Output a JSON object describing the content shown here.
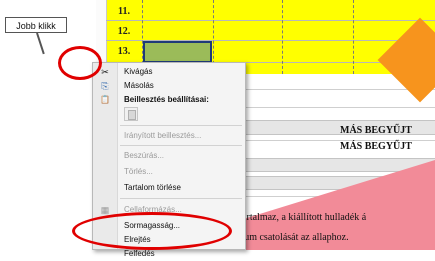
{
  "sheet": {
    "row_numbers": [
      "11.",
      "12.",
      "13."
    ],
    "mas_texts": [
      "MÁS BEGYŰJT",
      "MÁS BEGYŰJT"
    ],
    "bottom_texts": [
      "t tartalmaz, a kiállított hulladék á",
      "entum csatolását az allaphoz."
    ]
  },
  "callout": {
    "label": "Jobb klikk"
  },
  "context_menu": {
    "items": [
      {
        "label": "Kivágás",
        "icon": "scissors-icon",
        "glyph": "✂",
        "state": "enabled"
      },
      {
        "label": "Másolás",
        "icon": "copy-icon",
        "glyph": "⎘",
        "state": "enabled"
      },
      {
        "label": "Beillesztés beállításai:",
        "icon": "paste-icon",
        "glyph": "📋",
        "state": "header"
      },
      {
        "label": "Irányított beillesztés...",
        "state": "disabled"
      },
      {
        "label": "Beszúrás...",
        "state": "disabled"
      },
      {
        "label": "Törlés...",
        "state": "disabled"
      },
      {
        "label": "Tartalom törlése",
        "state": "enabled"
      },
      {
        "label": "Cellaformázás...",
        "icon": "format-cells-icon",
        "glyph": "▦",
        "state": "disabled"
      },
      {
        "label": "Sormagasság...",
        "state": "enabled"
      },
      {
        "label": "Elrejtés",
        "state": "enabled"
      },
      {
        "label": "Felfedés",
        "state": "enabled"
      }
    ]
  },
  "colors": {
    "highlight_yellow": "#ffff00",
    "selected_cell": "#9bbb59",
    "annotation_red": "#e00000",
    "arrow_orange": "#f7941d",
    "arrow_pink": "#f28b98"
  }
}
